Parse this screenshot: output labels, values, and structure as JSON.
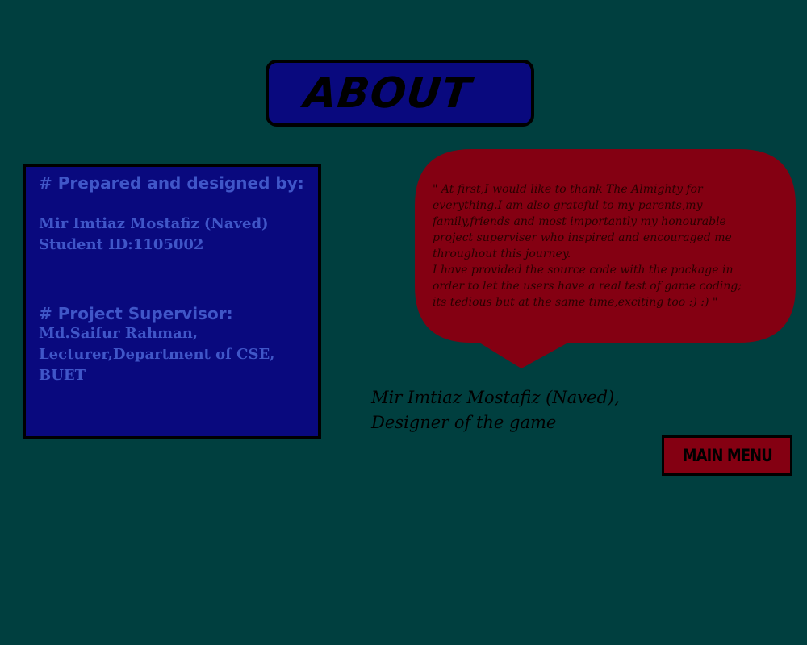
{
  "title": "ABOUT",
  "credits": {
    "prepared_heading": "# Prepared and designed by:",
    "author_name": "Mir Imtiaz Mostafiz (Naved)",
    "student_id": "Student ID:1105002",
    "supervisor_heading": "# Project Supervisor:",
    "supervisor_name": "Md.Saifur Rahman,",
    "supervisor_title": "Lecturer,Department of CSE,",
    "supervisor_institution": "BUET"
  },
  "message": "\" At first,I would like to thank The  Almighty for\neverything.I am also grateful to my parents,my\nfamily,friends and most importantly my honourable\nproject superviser  who inspired and encouraged me\nthroughout this journey.\n I have provided the source code with the package in\n order to let the users have a real test of game coding;\nits tedious but at the same time,exciting too :) :) \"",
  "signature": {
    "name": "Mir Imtiaz Mostafiz (Naved),",
    "role": "Designer of the game"
  },
  "menu_button_label": "MAIN MENU",
  "colors": {
    "background": "#003f3f",
    "panel_blue": "#09097e",
    "panel_text": "#4056c8",
    "speech_red": "#840012"
  }
}
